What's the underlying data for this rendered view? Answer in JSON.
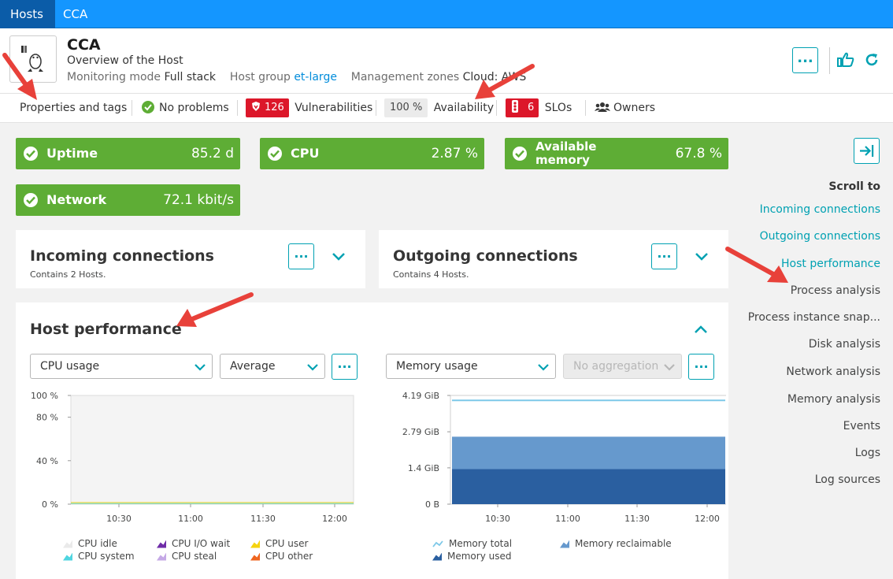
{
  "breadcrumb": {
    "hosts": "Hosts",
    "current": "CCA"
  },
  "host": {
    "name": "CCA",
    "subtitle": "Overview of the Host",
    "mode_label": "Monitoring mode",
    "mode_value": "Full stack",
    "group_label": "Host group",
    "group_value": "et-large",
    "zones_label": "Management zones",
    "zones_value": "Cloud: AWS",
    "more_button": "..."
  },
  "infobar": {
    "properties": "Properties and tags",
    "problems": "No problems",
    "vuln_count": "126",
    "vuln_label": "Vulnerabilities",
    "avail_value": "100 %",
    "avail_label": "Availability",
    "slo_count": "6",
    "slo_label": "SLOs",
    "owners": "Owners"
  },
  "tiles": [
    {
      "label": "Uptime",
      "value": "85.2 d"
    },
    {
      "label": "CPU",
      "value": "2.87 %"
    },
    {
      "label": "Available",
      "label2": "memory",
      "value": "67.8 %"
    },
    {
      "label": "Network",
      "value": "72.1 kbit/s"
    }
  ],
  "incoming": {
    "title": "Incoming connections",
    "sub": "Contains 2 Hosts."
  },
  "outgoing": {
    "title": "Outgoing connections",
    "sub": "Contains 4 Hosts."
  },
  "perf": {
    "title": "Host performance",
    "cpu_select": "CPU usage",
    "agg_select": "Average",
    "mem_select": "Memory usage",
    "mem_agg_select": "No aggregation"
  },
  "chart_data": [
    {
      "type": "area",
      "yticks": [
        "100 %",
        "80 %",
        "40 %",
        "0 %"
      ],
      "xticks": [
        "10:30",
        "11:00",
        "11:30",
        "12:00"
      ],
      "ylim": [
        0,
        100
      ],
      "series": [
        {
          "name": "CPU idle",
          "color": "#eaeaea"
        },
        {
          "name": "CPU I/O wait",
          "color": "#6f2da8"
        },
        {
          "name": "CPU user",
          "color": "#f5d30f"
        },
        {
          "name": "CPU system",
          "color": "#4fd5e0"
        },
        {
          "name": "CPU steal",
          "color": "#c5a9e6"
        },
        {
          "name": "CPU other",
          "color": "#ef651f"
        }
      ]
    },
    {
      "type": "area",
      "yticks": [
        "4.19 GiB",
        "2.79 GiB",
        "1.4 GiB",
        "0 B"
      ],
      "xticks": [
        "10:30",
        "11:00",
        "11:30",
        "12:00"
      ],
      "ylim": [
        0,
        4.19
      ],
      "series": [
        {
          "name": "Memory total",
          "color": "#7dc8e8",
          "values": [
            4.0
          ]
        },
        {
          "name": "Memory reclaimable",
          "color": "#6699cd",
          "values": [
            2.6
          ]
        },
        {
          "name": "Memory used",
          "color": "#2a5fa0",
          "values": [
            1.35
          ]
        }
      ]
    }
  ],
  "sidebar": {
    "scroll_to": "Scroll to",
    "items": [
      "Incoming connections",
      "Outgoing connections",
      "Host performance",
      "Process analysis",
      "Process instance snap...",
      "Disk analysis",
      "Network analysis",
      "Memory analysis",
      "Events",
      "Logs",
      "Log sources"
    ]
  },
  "colors": {
    "accent": "#00a1b2",
    "tile_green": "#5ead35",
    "badge_red": "#dc172a",
    "arrow_red": "#e8413a"
  }
}
